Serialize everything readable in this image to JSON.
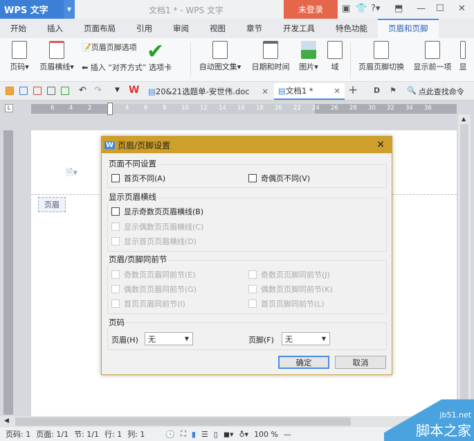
{
  "app": {
    "name": "WPS 文字",
    "doc_title": "文档1 * - WPS 文字",
    "login": "未登录"
  },
  "tabs": [
    "开始",
    "插入",
    "页面布局",
    "引用",
    "审阅",
    "视图",
    "章节",
    "开发工具",
    "特色功能",
    "页眉和页脚"
  ],
  "ribbon": {
    "page_number": "页码",
    "header_line": "页眉横线",
    "hf_options": "页眉页脚选项",
    "insert_align": "插入 “对齐方式” 选项卡",
    "auto_text": "自动图文集",
    "date_time": "日期和时间",
    "picture": "图片",
    "field": "域",
    "hf_switch": "页眉页脚切换",
    "show_prev": "显示前一项",
    "show_next": "显"
  },
  "doc_tabs": [
    {
      "label": "20&21选题单-安世伟.doc"
    },
    {
      "label": "文档1 *"
    }
  ],
  "search_placeholder": "点此查找命令",
  "ruler_ticks": [
    "6",
    "4",
    "2",
    "2",
    "4",
    "6",
    "8",
    "10",
    "12",
    "14",
    "16",
    "18",
    "20",
    "22",
    "24",
    "26",
    "28",
    "30",
    "32",
    "34",
    "36"
  ],
  "page": {
    "header_label": "页眉"
  },
  "dialog": {
    "title": "页眉/页脚设置",
    "g1": {
      "label": "页面不同设置",
      "first": "首页不同(A)",
      "odd_even": "奇偶页不同(V)"
    },
    "g2": {
      "label": "显示页眉横线",
      "odd": "显示奇数页页眉横线(B)",
      "even": "显示偶数页页眉横线(C)",
      "first": "显示首页页眉横线(D)"
    },
    "g3": {
      "label": "页眉/页脚同前节",
      "a": "奇数页页眉同前节(E)",
      "b": "奇数页页脚同前节(J)",
      "c": "偶数页页眉同前节(G)",
      "d": "偶数页页脚同前节(K)",
      "e": "首页页眉同前节(I)",
      "f": "首页页脚同前节(L)"
    },
    "g4": {
      "label": "页码",
      "header": "页眉(H)",
      "header_val": "无",
      "footer": "页脚(F)",
      "footer_val": "无"
    },
    "ok": "确定",
    "cancel": "取消"
  },
  "status": {
    "page_num": "页码: 1",
    "page": "页面: 1/1",
    "section": "节: 1/1",
    "row": "行: 1",
    "col": "列: 1",
    "zoom": "100 %"
  },
  "watermark": {
    "site": "jb51.net",
    "name": "脚本之家"
  }
}
